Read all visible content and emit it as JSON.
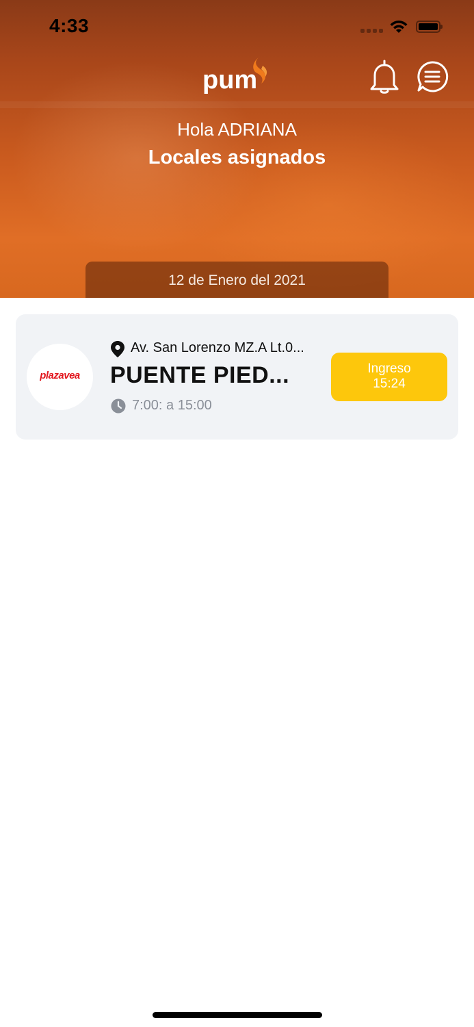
{
  "status_bar": {
    "time": "4:33"
  },
  "header": {
    "logo_text": "pum",
    "greeting": "Hola ADRIANA",
    "title": "Locales asignados",
    "date": "12 de Enero del 2021"
  },
  "icons": {
    "notifications": "bell-icon",
    "menu": "chat-menu-icon"
  },
  "stores": [
    {
      "brand": "plazavea",
      "address": "Av. San Lorenzo MZ.A Lt.0...",
      "name": "PUENTE PIED...",
      "schedule": "7:00: a 15:00",
      "button_line1": "Ingreso",
      "button_line2": "15:24"
    }
  ],
  "colors": {
    "header_orange": "#d8681f",
    "button_yellow": "#fdc70c",
    "card_bg": "#f1f3f6",
    "brand_red": "#e2161d"
  }
}
